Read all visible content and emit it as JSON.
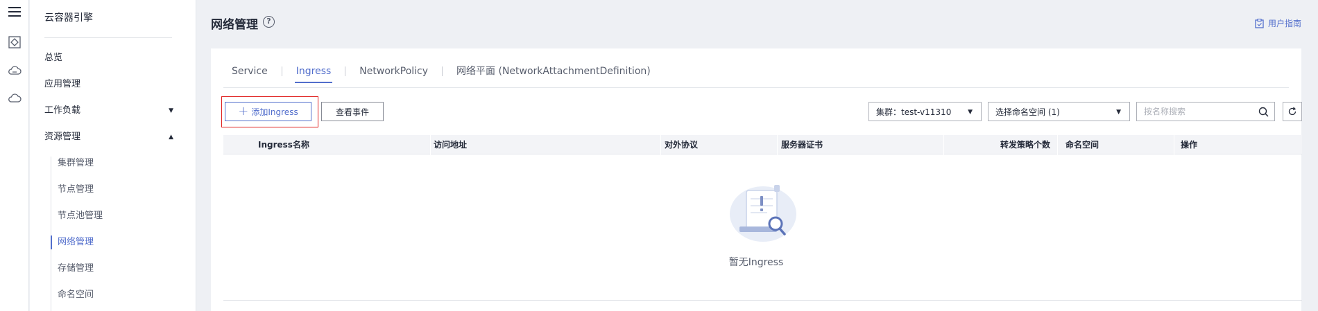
{
  "sidebar": {
    "title": "云容器引擎",
    "items": [
      {
        "label": "总览"
      },
      {
        "label": "应用管理"
      },
      {
        "label": "工作负载"
      },
      {
        "label": "资源管理"
      }
    ],
    "sub_items": [
      {
        "label": "集群管理"
      },
      {
        "label": "节点管理"
      },
      {
        "label": "节点池管理"
      },
      {
        "label": "网络管理",
        "active": true
      },
      {
        "label": "存储管理"
      },
      {
        "label": "命名空间"
      }
    ]
  },
  "header": {
    "title": "网络管理",
    "help_icon": "?",
    "guide_label": "用户指南"
  },
  "tabs": [
    {
      "label": "Service"
    },
    {
      "label": "Ingress",
      "active": true
    },
    {
      "label": "NetworkPolicy"
    },
    {
      "label": "网络平面 (NetworkAttachmentDefinition)"
    }
  ],
  "toolbar": {
    "add_label": "添加Ingress",
    "events_label": "查看事件",
    "cluster_select": "集群：test-v11310",
    "namespace_select": "选择命名空间 (1)",
    "search_placeholder": "按名称搜索"
  },
  "table": {
    "columns": [
      {
        "label": "Ingress名称"
      },
      {
        "label": "访问地址"
      },
      {
        "label": "对外协议"
      },
      {
        "label": "服务器证书"
      },
      {
        "label": "转发策略个数"
      },
      {
        "label": "命名空间"
      },
      {
        "label": "操作"
      }
    ],
    "empty_text": "暂无Ingress"
  },
  "colors": {
    "accent": "#526ecc",
    "highlight": "#e0201f"
  }
}
